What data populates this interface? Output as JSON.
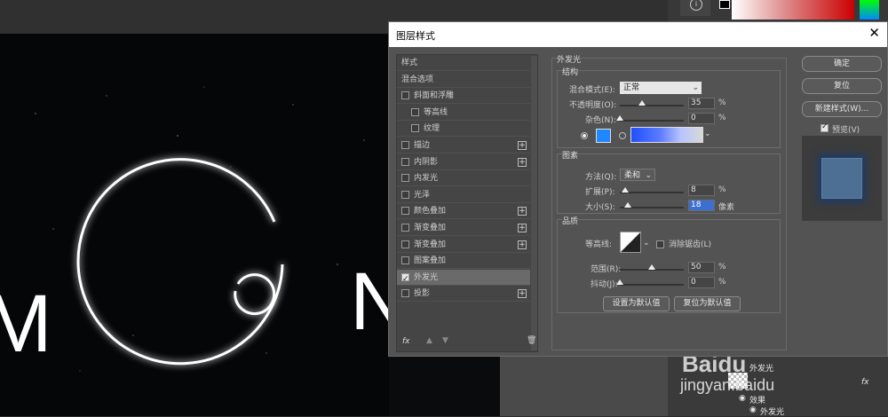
{
  "window": {
    "title": "图层样式",
    "close_icon": "close-icon"
  },
  "canvas_text": {
    "letter_left": "M",
    "letter_right": "N"
  },
  "styles_list": {
    "items": [
      {
        "label": "样式",
        "checkbox": false,
        "plus": false,
        "indent": 0,
        "checked": false,
        "selected": false
      },
      {
        "label": "混合选项",
        "checkbox": false,
        "plus": false,
        "indent": 0,
        "checked": false,
        "selected": false
      },
      {
        "label": "斜面和浮雕",
        "checkbox": true,
        "plus": false,
        "indent": 0,
        "checked": false,
        "selected": false
      },
      {
        "label": "等高线",
        "checkbox": true,
        "plus": false,
        "indent": 1,
        "checked": false,
        "selected": false
      },
      {
        "label": "纹理",
        "checkbox": true,
        "plus": false,
        "indent": 1,
        "checked": false,
        "selected": false
      },
      {
        "label": "描边",
        "checkbox": true,
        "plus": true,
        "indent": 0,
        "checked": false,
        "selected": false
      },
      {
        "label": "内阴影",
        "checkbox": true,
        "plus": true,
        "indent": 0,
        "checked": false,
        "selected": false
      },
      {
        "label": "内发光",
        "checkbox": true,
        "plus": false,
        "indent": 0,
        "checked": false,
        "selected": false
      },
      {
        "label": "光泽",
        "checkbox": true,
        "plus": false,
        "indent": 0,
        "checked": false,
        "selected": false
      },
      {
        "label": "颜色叠加",
        "checkbox": true,
        "plus": true,
        "indent": 0,
        "checked": false,
        "selected": false
      },
      {
        "label": "渐变叠加",
        "checkbox": true,
        "plus": true,
        "indent": 0,
        "checked": false,
        "selected": false
      },
      {
        "label": "渐变叠加",
        "checkbox": true,
        "plus": true,
        "indent": 0,
        "checked": false,
        "selected": false
      },
      {
        "label": "图案叠加",
        "checkbox": true,
        "plus": false,
        "indent": 0,
        "checked": false,
        "selected": false
      },
      {
        "label": "外发光",
        "checkbox": true,
        "plus": false,
        "indent": 0,
        "checked": true,
        "selected": true
      },
      {
        "label": "投影",
        "checkbox": true,
        "plus": true,
        "indent": 0,
        "checked": false,
        "selected": false
      }
    ],
    "bottom": {
      "fx": "fx",
      "up_icon": "arrow-up-icon",
      "down_icon": "arrow-down-icon",
      "trash_icon": "trash-icon"
    }
  },
  "outer_glow": {
    "section_title": "外发光",
    "structure": {
      "title": "结构",
      "blend_mode_label": "混合模式(E):",
      "blend_mode_value": "正常",
      "opacity_label": "不透明度(O):",
      "opacity_value": "35",
      "opacity_unit": "%",
      "noise_label": "杂色(N):",
      "noise_value": "0",
      "noise_unit": "%",
      "color": "#1f87ff"
    },
    "elements": {
      "title": "图素",
      "method_label": "方法(Q):",
      "method_value": "柔和",
      "spread_label": "扩展(P):",
      "spread_value": "8",
      "spread_unit": "%",
      "size_label": "大小(S):",
      "size_value": "18",
      "size_unit": "像素"
    },
    "quality": {
      "title": "品质",
      "contour_label": "等高线:",
      "antialias_label": "消除锯齿(L)",
      "range_label": "范围(R):",
      "range_value": "50",
      "range_unit": "%",
      "jitter_label": "抖动(J):",
      "jitter_value": "0",
      "jitter_unit": "%"
    },
    "make_default": "设置为默认值",
    "reset_default": "复位为默认值"
  },
  "right_buttons": {
    "ok": "确定",
    "reset": "复位",
    "new_style": "新建样式(W)...",
    "preview_label": "预览(V)",
    "preview_checked": true
  },
  "layers_panel": {
    "row1": "外发光",
    "effects": "效果",
    "row3": "外发光",
    "fx": "fx"
  },
  "watermark": {
    "line1": "Baidu",
    "line2": "jingyan.baidu"
  }
}
